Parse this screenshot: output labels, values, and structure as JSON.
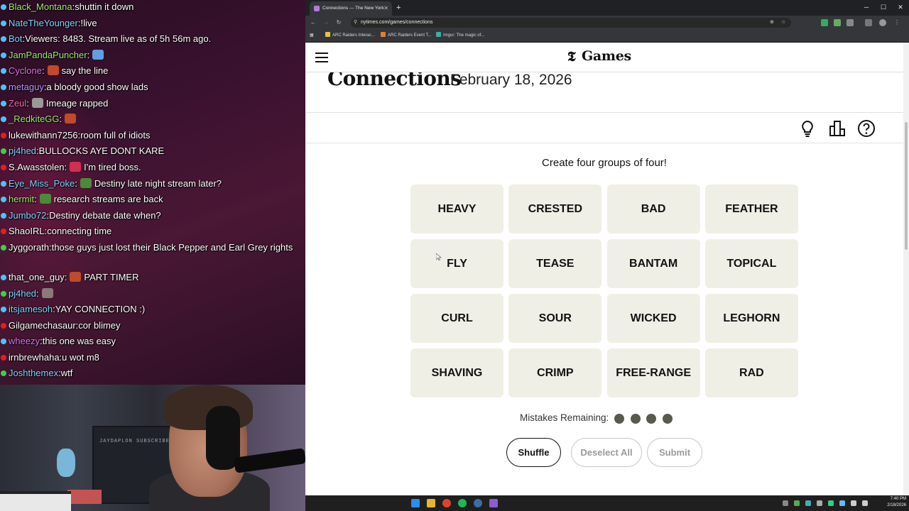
{
  "chat": {
    "messages": [
      {
        "user": "Black_Montana",
        "text": "shuttin it down",
        "color": "#9fe870",
        "badge": "#4cc3ff",
        "emote": ""
      },
      {
        "user": "NateTheYounger",
        "text": "!live",
        "color": "#7fd3ff",
        "badge": "#4cc3ff",
        "emote": ""
      },
      {
        "user": "Bot",
        "text": "Viewers: 8483. Stream live as of 5h 56m ago.",
        "color": "#7fd3ff",
        "badge": "#4cc3ff",
        "emote": ""
      },
      {
        "user": "JamPandaPuncher",
        "text": "",
        "color": "#9fe870",
        "badge": "#4cc3ff",
        "emote": "#5fa0e0"
      },
      {
        "user": "Cyclone",
        "text": "say the line",
        "color": "#e070e8",
        "badge": "#4cc3ff",
        "emote": "#c04a2a"
      },
      {
        "user": "metaguy",
        "text": "a bloody good show lads",
        "color": "#b494ff",
        "badge": "#4cc3ff",
        "emote": ""
      },
      {
        "user": "Zeul",
        "text": "Imeage rapped",
        "color": "#ff62a8",
        "badge": "#4cc3ff",
        "emote": "#9a9a9a"
      },
      {
        "user": "_RedkiteGG",
        "text": "",
        "color": "#9fe870",
        "badge": "#4cc3ff",
        "emote": "#c04a2a"
      },
      {
        "user": "lukewithann7256",
        "text": "room full of idiots",
        "color": "#ffffff",
        "badge": "#e02020",
        "emote": ""
      },
      {
        "user": "pj4hed",
        "text": "BULLOCKS AYE DONT KARE",
        "color": "#7fd3ff",
        "badge": "#3cd04a",
        "emote": ""
      },
      {
        "user": "S.Awasstolen",
        "text": "I'm tired boss.",
        "color": "#ffffff",
        "badge": "#e02020",
        "emote": "#d03050"
      },
      {
        "user": "Eye_Miss_Poke",
        "text": "Destiny late night stream later?",
        "color": "#7fd3ff",
        "badge": "#4cc3ff",
        "emote": "#4a8a3a"
      },
      {
        "user": "hermit",
        "text": "research streams are back",
        "color": "#9fe870",
        "badge": "#4cc3ff",
        "emote": "#4a8a3a"
      },
      {
        "user": "Jumbo72",
        "text": "Destiny debate date when?",
        "color": "#7fd3ff",
        "badge": "#4cc3ff",
        "emote": ""
      },
      {
        "user": "ShaoIRL",
        "text": "connecting time",
        "color": "#ffffff",
        "badge": "#e02020",
        "emote": ""
      },
      {
        "user": "Jyggorath",
        "text": "those guys just lost their Black Pepper and Earl Grey rights",
        "color": "#ffffff",
        "badge": "#3cd04a",
        "emote": ""
      },
      {
        "user": "that_one_guy",
        "text": "PART TIMER",
        "color": "#ffffff",
        "badge": "#4cc3ff",
        "emote": "#c04a2a"
      },
      {
        "user": "pj4hed",
        "text": "",
        "color": "#7fd3ff",
        "badge": "#3cd04a",
        "emote": "#8a7a7a"
      },
      {
        "user": "itsjamesoh",
        "text": "YAY CONNECTION :)",
        "color": "#7fd3ff",
        "badge": "#4cc3ff",
        "emote": ""
      },
      {
        "user": "Gilgamechasaur",
        "text": "cor blimey",
        "color": "#ffffff",
        "badge": "#e02020",
        "emote": ""
      },
      {
        "user": "wheezy",
        "text": "this one was easy",
        "color": "#e070e8",
        "badge": "#4cc3ff",
        "emote": ""
      },
      {
        "user": "irnbrewhaha",
        "text": "u wot m8",
        "color": "#ffffff",
        "badge": "#e02020",
        "emote": ""
      },
      {
        "user": "Joshthemex",
        "text": "wtf",
        "color": "#7fd3ff",
        "badge": "#3cd04a",
        "emote": ""
      }
    ]
  },
  "webcam": {
    "shelf_text": "JAYDAPLON SUBSCRIBE"
  },
  "browser": {
    "tab_title": "Connections — The New York",
    "url": "nytimes.com/games/connections",
    "bookmarks": [
      "ARC Raiders Interac...",
      "ARC Raiders Event T...",
      "Imgur: The magic of..."
    ]
  },
  "page": {
    "brand": "Games",
    "game_title": "Connections",
    "date": "February 18, 2026",
    "instructions": "Create four groups of four!",
    "words": [
      "HEAVY",
      "CRESTED",
      "BAD",
      "FEATHER",
      "FLY",
      "TEASE",
      "BANTAM",
      "TOPICAL",
      "CURL",
      "SOUR",
      "WICKED",
      "LEGHORN",
      "SHAVING",
      "CRIMP",
      "FREE-RANGE",
      "RAD"
    ],
    "mistakes_label": "Mistakes Remaining:",
    "mistakes_remaining": 4,
    "buttons": {
      "shuffle": "Shuffle",
      "deselect": "Deselect All",
      "submit": "Submit"
    },
    "colors": {
      "card_bg": "#efefe6",
      "dot": "#5a594e",
      "text": "#121212"
    }
  },
  "taskbar": {
    "time": "7:40 PM",
    "date": "2/18/2026"
  }
}
